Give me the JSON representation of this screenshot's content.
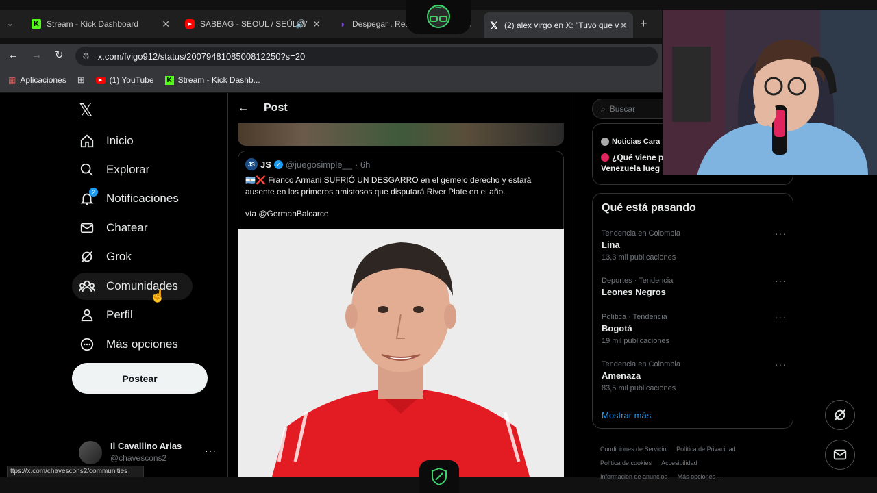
{
  "browser": {
    "tabs": [
      {
        "label": "Stream - Kick Dashboard",
        "icon": "kick-icon",
        "color": "#53fc18"
      },
      {
        "label": "SABBAG - SEOUL / SEÚL (V",
        "icon": "youtube-icon",
        "color": "#ff0000"
      },
      {
        "label": "Despegar . Resulta",
        "icon": "despegar-icon",
        "color": "#7b3cff"
      },
      {
        "label": "(2) alex virgo en X: \"Tuvo que v",
        "icon": "x-icon",
        "color": "#ffffff"
      }
    ],
    "url": "x.com/fvigo912/status/2007948108500812250?s=20",
    "bookmarks": [
      "Aplicaciones",
      "(1) YouTube",
      "Stream - Kick Dashb..."
    ],
    "status_url": "ttps://x.com/chavescons2/communities"
  },
  "nav": {
    "items": [
      {
        "label": "Inicio",
        "icon": "home-icon"
      },
      {
        "label": "Explorar",
        "icon": "search-icon"
      },
      {
        "label": "Notificaciones",
        "icon": "bell-icon",
        "badge": "2"
      },
      {
        "label": "Chatear",
        "icon": "mail-icon"
      },
      {
        "label": "Grok",
        "icon": "grok-icon"
      },
      {
        "label": "Comunidades",
        "icon": "communities-icon"
      },
      {
        "label": "Perfil",
        "icon": "profile-icon"
      },
      {
        "label": "Más opciones",
        "icon": "more-icon"
      }
    ],
    "post_button": "Postear",
    "account": {
      "name": "Il Cavallino Arias",
      "handle": "@chavescons2"
    }
  },
  "post": {
    "header": "Post",
    "quote": {
      "name": "JS",
      "handle": "@juegosimple__",
      "time": "· 6h",
      "text": "🇦🇷❌ Franco Armani SUFRIÓ UN DESGARRO en el gemelo derecho y estará ausente en los primeros amistosos que disputará River Plate en el año.",
      "via": "vía @GermanBalcarce"
    }
  },
  "sidebar": {
    "search_placeholder": "Buscar",
    "news_title": "Noticias Cara",
    "news_line1": "¿Qué viene p",
    "news_line2": "Venezuela lueg",
    "trends_title": "Qué está pasando",
    "trends": [
      {
        "context": "Tendencia en Colombia",
        "name": "Lina",
        "count": "13,3 mil publicaciones"
      },
      {
        "context": "Deportes · Tendencia",
        "name": "Leones Negros",
        "count": ""
      },
      {
        "context": "Política · Tendencia",
        "name": "Bogotá",
        "count": "19 mil publicaciones"
      },
      {
        "context": "Tendencia en Colombia",
        "name": "Amenaza",
        "count": "83,5 mil publicaciones"
      }
    ],
    "show_more": "Mostrar más",
    "footer": [
      "Condiciones de Servicio",
      "Política de Privacidad",
      "Política de cookies",
      "Accesibilidad",
      "Información de anuncios",
      "Más opciones ···"
    ]
  }
}
